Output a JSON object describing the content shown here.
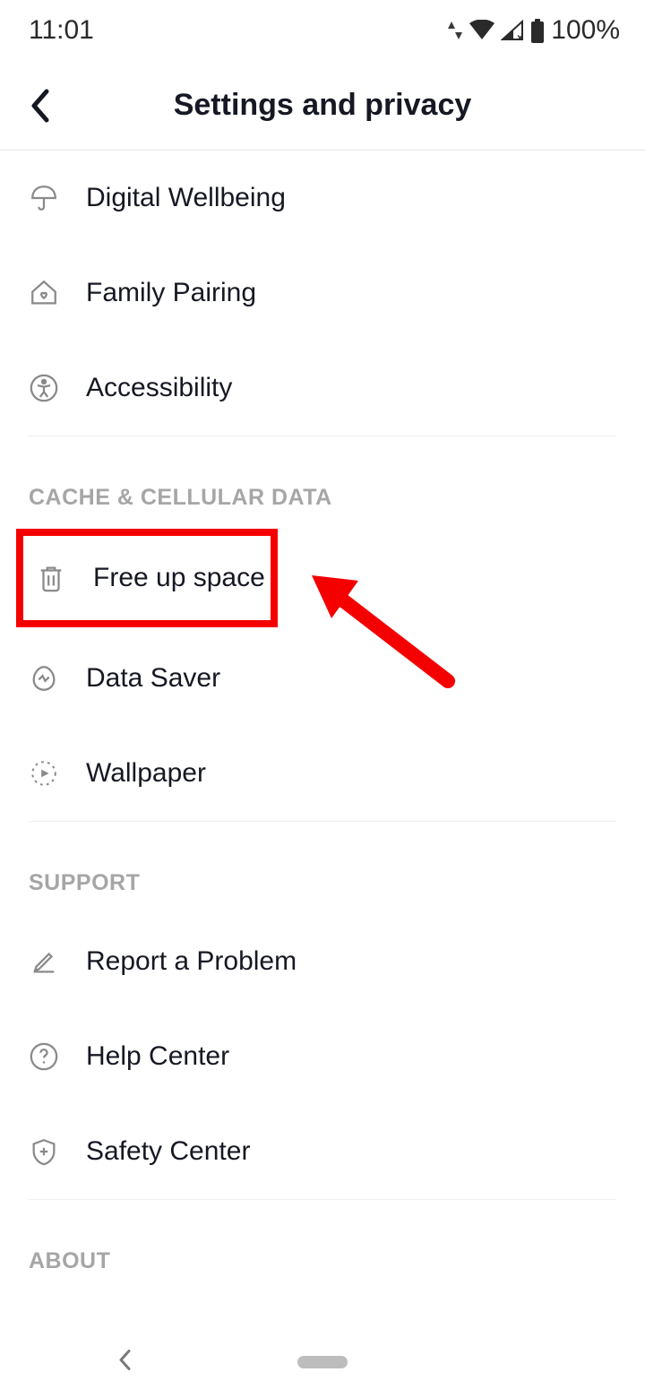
{
  "statusbar": {
    "time": "11:01",
    "battery": "100%"
  },
  "header": {
    "title": "Settings and privacy"
  },
  "groups": {
    "g0": {
      "items": [
        {
          "label": "Digital Wellbeing"
        },
        {
          "label": "Family Pairing"
        },
        {
          "label": "Accessibility"
        }
      ]
    },
    "g1": {
      "header": "CACHE & CELLULAR DATA",
      "items": [
        {
          "label": "Free up space"
        },
        {
          "label": "Data Saver"
        },
        {
          "label": "Wallpaper"
        }
      ]
    },
    "g2": {
      "header": "SUPPORT",
      "items": [
        {
          "label": "Report a Problem"
        },
        {
          "label": "Help Center"
        },
        {
          "label": "Safety Center"
        }
      ]
    },
    "g3": {
      "header": "ABOUT"
    }
  }
}
